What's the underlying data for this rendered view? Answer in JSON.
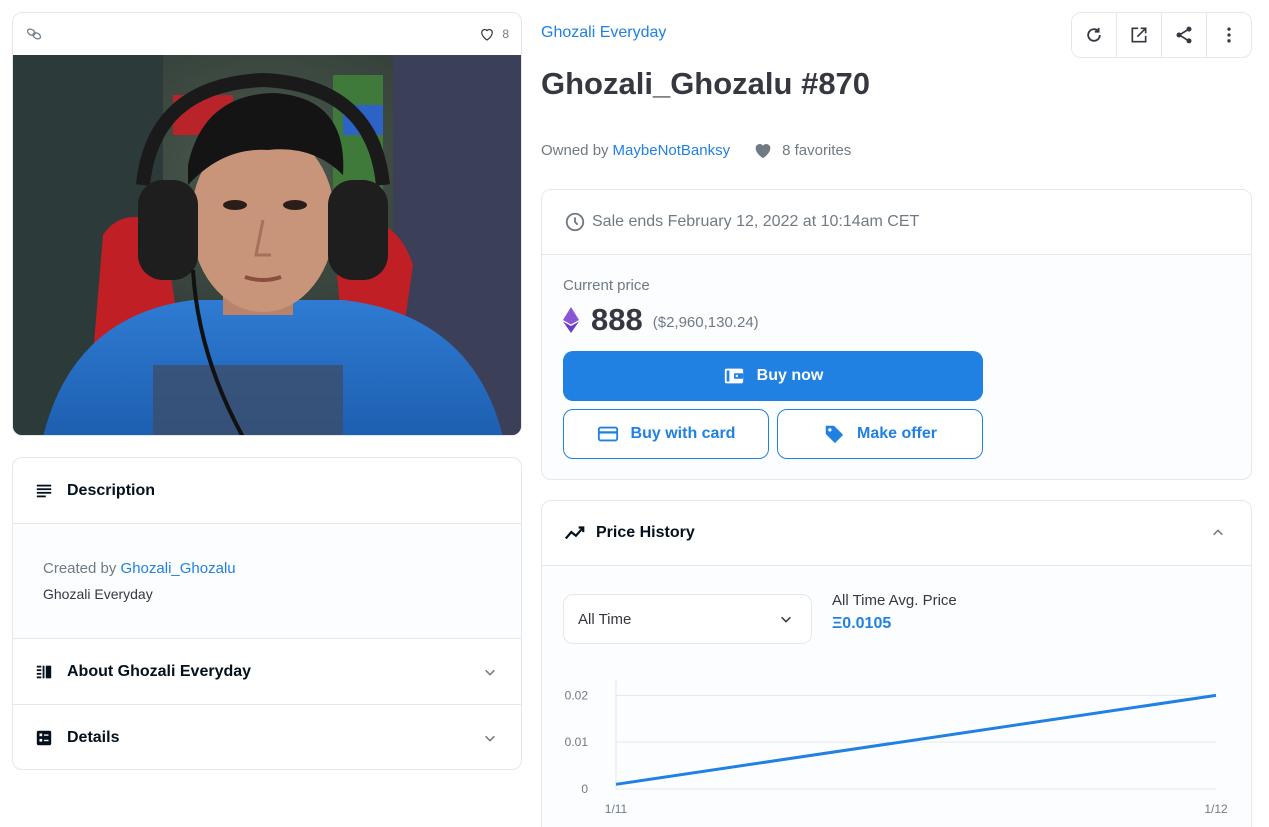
{
  "media": {
    "favorite_count": "8"
  },
  "description": {
    "heading": "Description",
    "created_by_prefix": "Created by",
    "creator": "Ghozali_Ghozalu",
    "text": "Ghozali Everyday"
  },
  "about": {
    "heading": "About Ghozali Everyday"
  },
  "details": {
    "heading": "Details"
  },
  "item": {
    "collection": "Ghozali Everyday",
    "title": "Ghozali_Ghozalu #870",
    "owned_by_prefix": "Owned by",
    "owner": "MaybeNotBanksy",
    "favorites": "8 favorites"
  },
  "toolbar": {
    "icons": [
      "refresh-icon",
      "external-link-icon",
      "share-icon",
      "more-icon"
    ]
  },
  "sale": {
    "ends": "Sale ends February 12, 2022 at 10:14am CET",
    "current_price_label": "Current price",
    "price": "888",
    "price_usd": "($2,960,130.24)",
    "buy_now": "Buy now",
    "buy_with_card": "Buy with card",
    "make_offer": "Make offer"
  },
  "price_history": {
    "heading": "Price History",
    "range": "All Time",
    "avg_label": "All Time Avg. Price",
    "avg_value": "Ξ0.0105"
  },
  "colors": {
    "accent": "#2081e2",
    "text": "#353840",
    "muted": "#707a83",
    "border": "#e5e8eb"
  },
  "chart_data": {
    "type": "line",
    "x": [
      "1/11",
      "1/12"
    ],
    "series": [
      {
        "values": [
          0.001,
          0.02
        ]
      }
    ],
    "y_ticks": [
      "0",
      "0.01",
      "0.02"
    ],
    "ylim": [
      0,
      0.022
    ],
    "grid": true
  }
}
